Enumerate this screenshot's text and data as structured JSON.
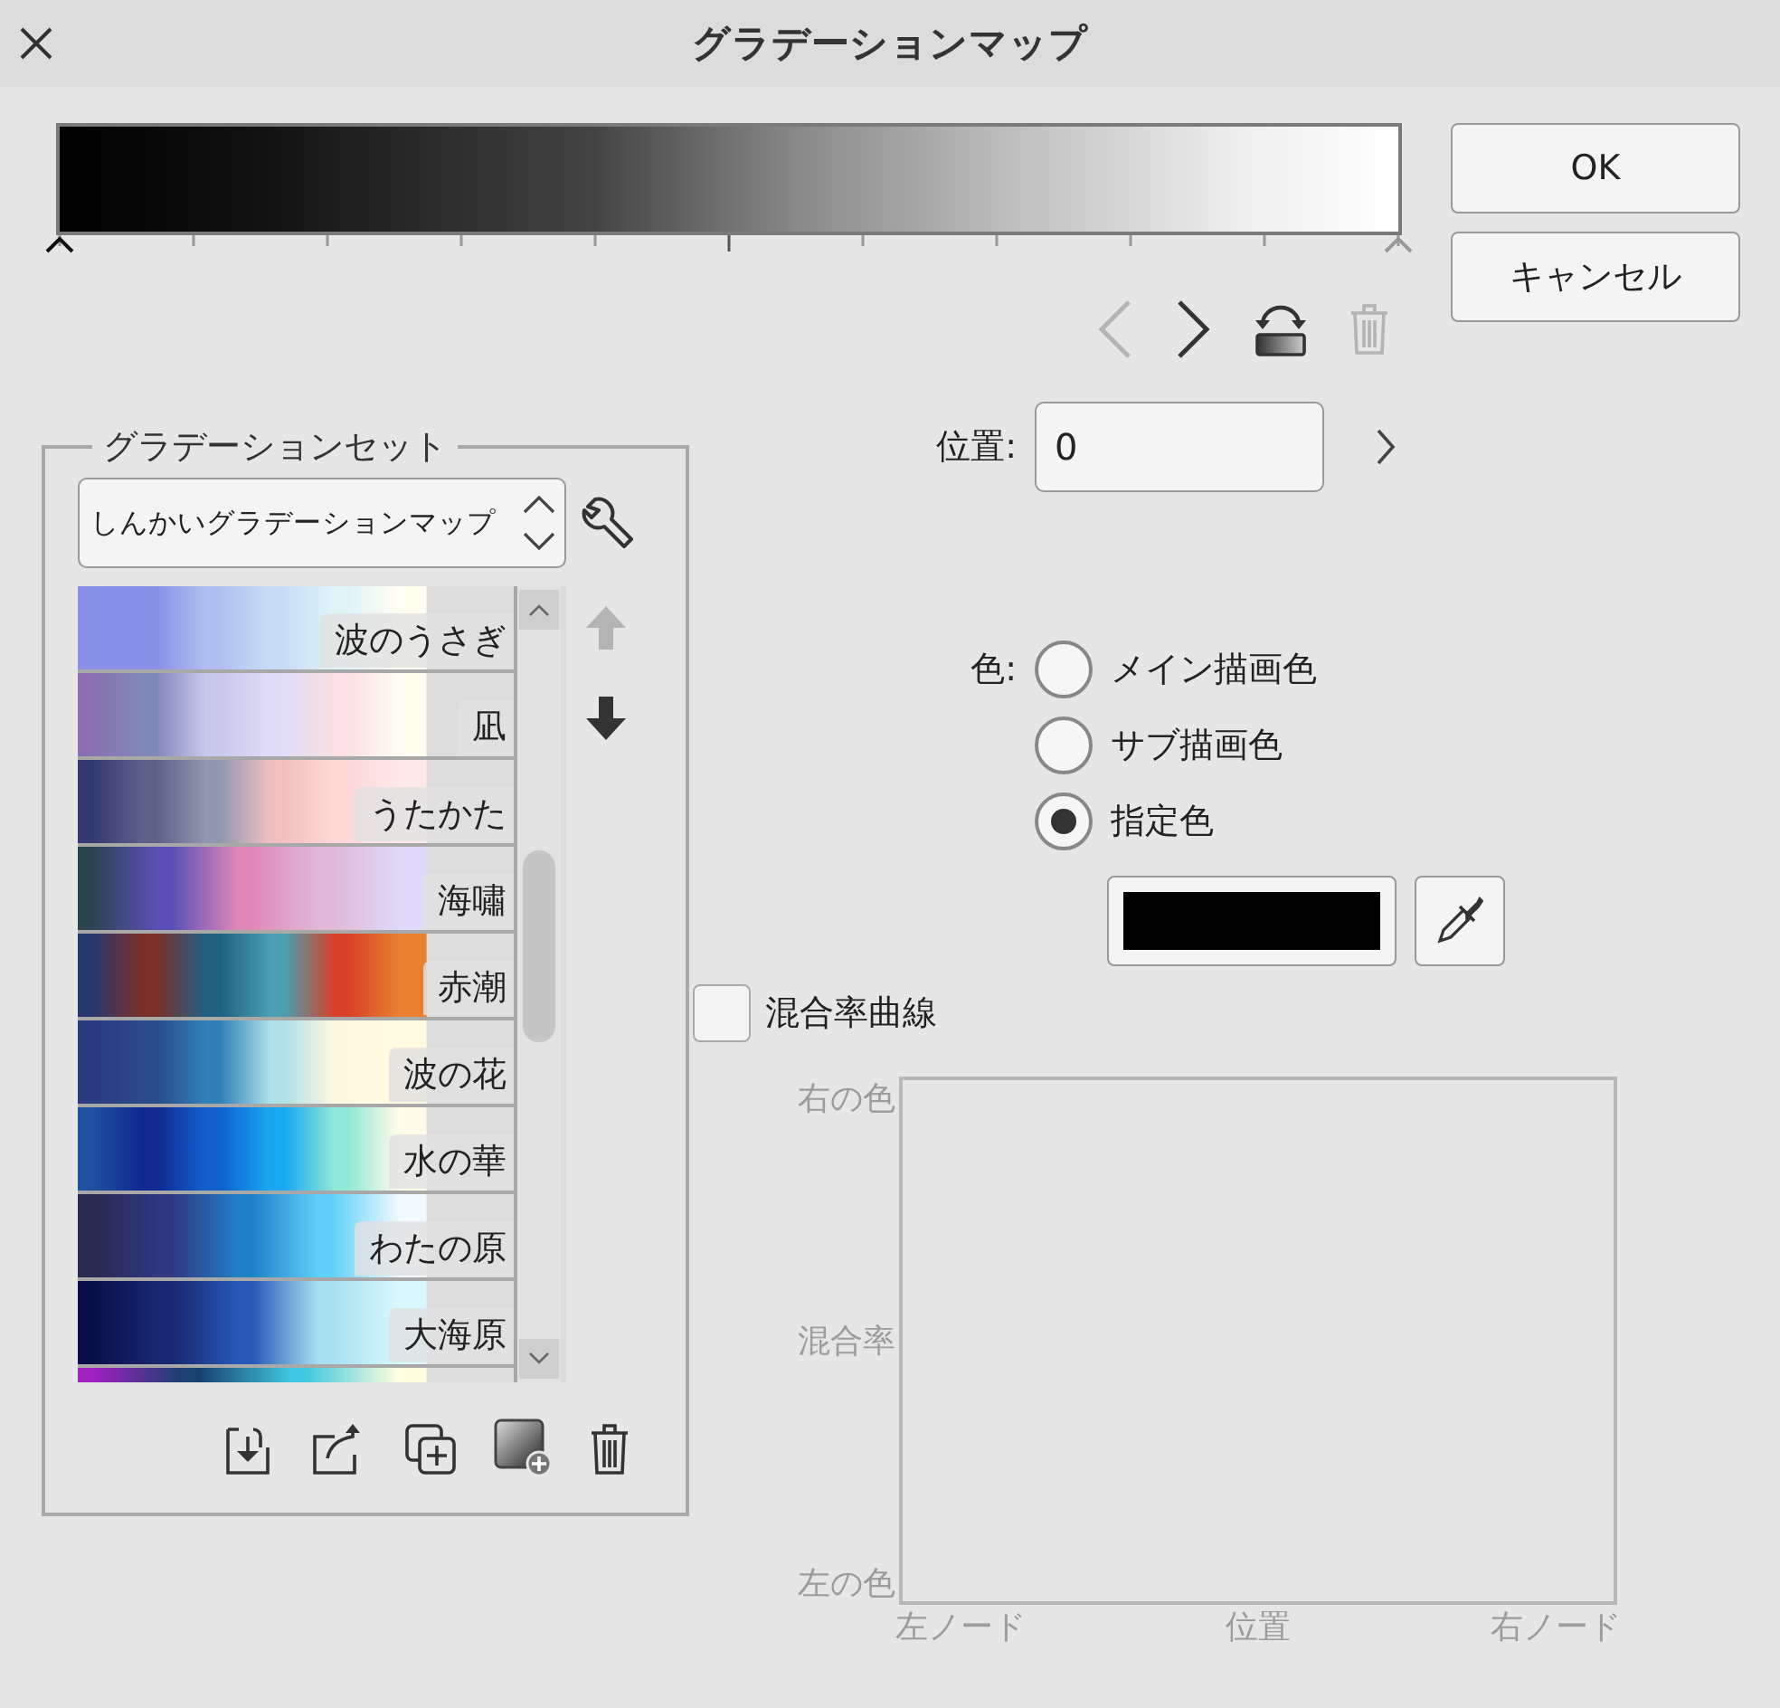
{
  "window": {
    "title": "グラデーションマップ"
  },
  "gradient_bar": {
    "nodes": [
      {
        "level": 0,
        "selected": true
      },
      {
        "level": 1,
        "selected": false
      }
    ]
  },
  "node_tools": [
    {
      "kind": "prev",
      "disabled": true
    },
    {
      "kind": "next",
      "disabled": false
    },
    {
      "kind": "reverse",
      "disabled": false
    },
    {
      "kind": "delete",
      "disabled": true
    }
  ],
  "buttons": [
    {
      "label": "OK"
    },
    {
      "label": "キャンセル"
    }
  ],
  "gradient_set": {
    "title": "グラデーションセット",
    "set_select": {
      "value": "しんかいグラデーションマップ"
    },
    "items": [
      {
        "name": "波のうさぎ",
        "stops": [
          {
            "color": "#8890e8"
          },
          {
            "color": "#8890e8"
          },
          {
            "color": "#b0bff0"
          },
          {
            "color": "#c8dcf5"
          },
          {
            "color": "#e0f4f8"
          },
          {
            "color": "#fffef0"
          }
        ]
      },
      {
        "name": "凪",
        "stops": [
          {
            "color": "#8a70b0"
          },
          {
            "color": "#8088b8"
          },
          {
            "color": "#c8c8ec"
          },
          {
            "color": "#e0dcf8"
          },
          {
            "color": "#fbe0e4"
          },
          {
            "color": "#fffcf0"
          }
        ]
      },
      {
        "name": "うたかた",
        "stops": [
          {
            "color": "#343a70"
          },
          {
            "color": "#5c6088"
          },
          {
            "color": "#9098b0"
          },
          {
            "color": "#f0c0c0"
          },
          {
            "color": "#ffd8d8"
          },
          {
            "color": "#ffe8e8"
          }
        ]
      },
      {
        "name": "海嘯",
        "stops": [
          {
            "color": "#2c4450"
          },
          {
            "color": "#5a50b8"
          },
          {
            "color": "#e088b8"
          },
          {
            "color": "#e0b8d8"
          },
          {
            "color": "#e0d8f8"
          }
        ]
      },
      {
        "name": "赤潮",
        "stops": [
          {
            "color": "#26386e"
          },
          {
            "color": "#7a3028"
          },
          {
            "color": "#206080"
          },
          {
            "color": "#48a0b0"
          },
          {
            "color": "#d84028"
          },
          {
            "color": "#e88030"
          }
        ]
      },
      {
        "name": "波の花",
        "stops": [
          {
            "color": "#2a3a80"
          },
          {
            "color": "#2a4a88"
          },
          {
            "color": "#3080b8"
          },
          {
            "color": "#b0e0e8"
          },
          {
            "color": "#fff8e0"
          },
          {
            "color": "#fffbe0"
          }
        ]
      },
      {
        "name": "水の華",
        "stops": [
          {
            "color": "#2050a0"
          },
          {
            "color": "#102890"
          },
          {
            "color": "#1060d0"
          },
          {
            "color": "#18a8f0"
          },
          {
            "color": "#90e8d8"
          },
          {
            "color": "#fffce8"
          }
        ]
      },
      {
        "name": "わたの原",
        "stops": [
          {
            "color": "#282a50"
          },
          {
            "color": "#303880"
          },
          {
            "color": "#2080c8"
          },
          {
            "color": "#60d0f8"
          },
          {
            "color": "#f0faff"
          }
        ]
      },
      {
        "name": "大海原",
        "stops": [
          {
            "color": "#0a0e48"
          },
          {
            "color": "#182870"
          },
          {
            "color": "#2858b8"
          },
          {
            "color": "#a8e0f0"
          },
          {
            "color": "#d8f8ff"
          }
        ]
      },
      {
        "stops": [
          {
            "color": "#a020c0"
          },
          {
            "color": "#184070"
          },
          {
            "color": "#40c8e0"
          },
          {
            "color": "#ffffe0"
          }
        ]
      }
    ],
    "move_buttons": [
      {
        "kind": "up",
        "disabled": true
      },
      {
        "kind": "down",
        "disabled": false
      }
    ],
    "actions": [
      {
        "kind": "import"
      },
      {
        "kind": "export"
      },
      {
        "kind": "duplicate"
      },
      {
        "kind": "add"
      },
      {
        "kind": "delete"
      }
    ]
  },
  "position": {
    "label": "位置:",
    "value": "0"
  },
  "color": {
    "label": "色:",
    "options": [
      {
        "label": "メイン描画色",
        "selected": false
      },
      {
        "label": "サブ描画色",
        "selected": false
      },
      {
        "label": "指定色",
        "selected": true
      }
    ],
    "swatch": {
      "color": "#000000"
    }
  },
  "blend_curve": {
    "label": "混合率曲線",
    "checked": false,
    "y_labels": [
      "右の色",
      "混合率",
      "左の色"
    ],
    "x_labels": [
      "左ノード",
      "位置",
      "右ノード"
    ]
  }
}
